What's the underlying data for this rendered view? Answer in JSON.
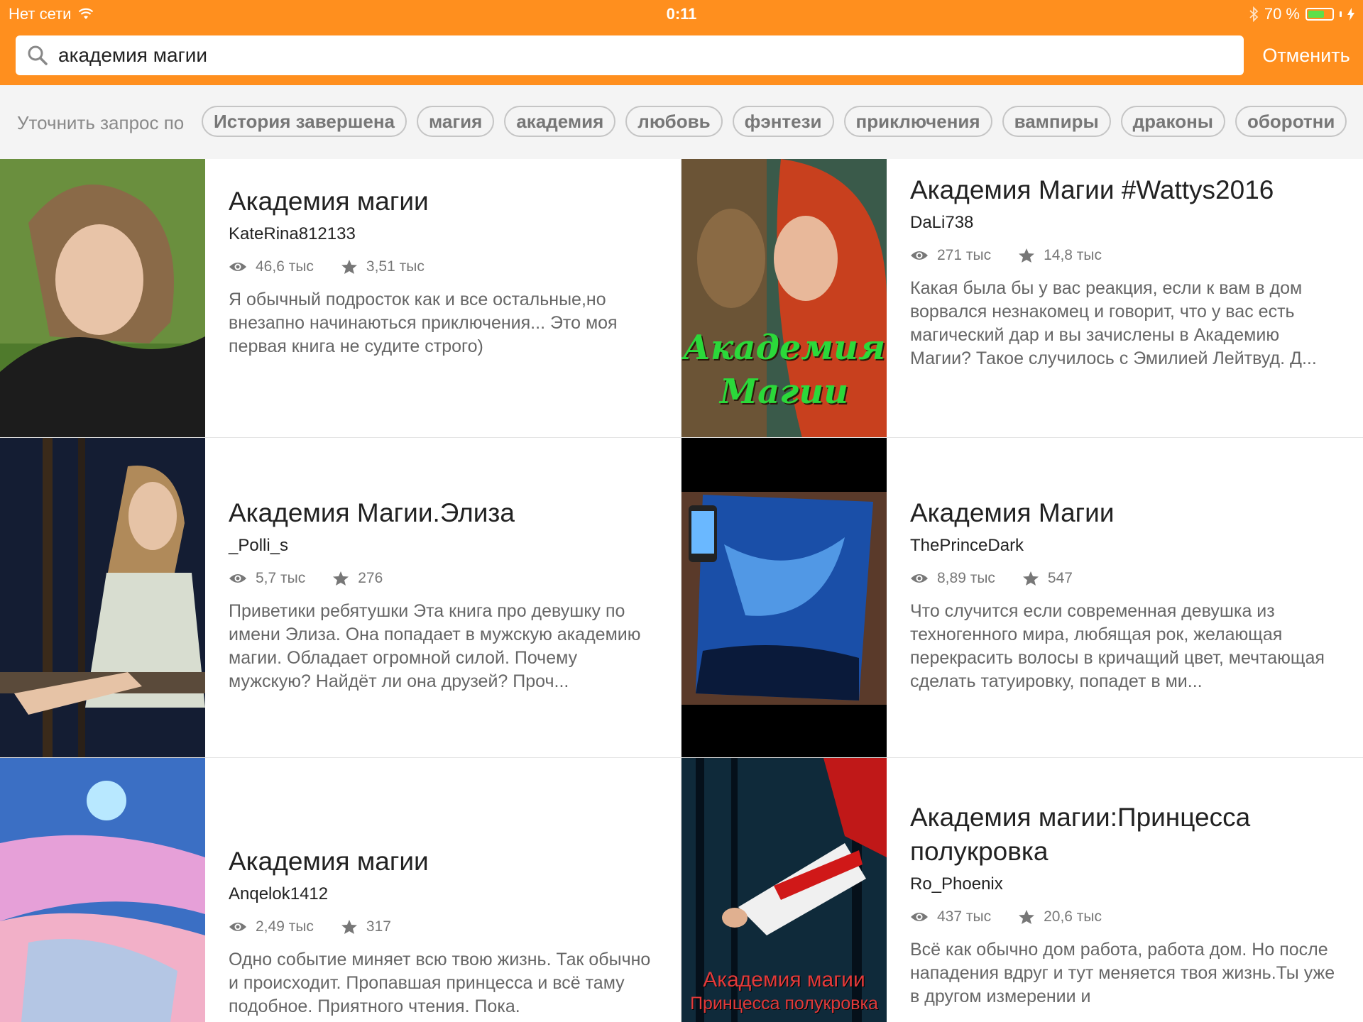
{
  "status": {
    "network": "Нет сети",
    "time": "0:11",
    "battery": "70 %",
    "battery_level": 0.7
  },
  "search": {
    "query": "академия магии",
    "cancel_label": "Отменить"
  },
  "filters": {
    "label": "Уточнить запрос по",
    "chips": [
      "История завершена",
      "магия",
      "академия",
      "любовь",
      "фэнтези",
      "приключения",
      "вампиры",
      "драконы",
      "оборотни"
    ]
  },
  "stories": [
    {
      "title": "Академия магии",
      "author": "KateRina812133",
      "views": "46,6 тыс",
      "votes": "3,51 тыс",
      "description": "Я обычный подросток как и все остальные,но внезапно начинаються приключения... Это моя первая книга не судите строго)"
    },
    {
      "title": "Академия Магии #Wattys2016",
      "author": "DaLi738",
      "views": "271 тыс",
      "votes": "14,8 тыс",
      "description": "Какая была бы у вас реакция, если к вам в дом ворвался незнакомец и говорит, что у вас есть магический дар и вы зачислены в Академию Магии? Такое случилось с Эмилией Лейтвуд. Д...",
      "cover_text": [
        "Академия",
        "Магии"
      ]
    },
    {
      "title": "Академия Магии.Элиза",
      "author": "_Polli_s",
      "views": "5,7 тыс",
      "votes": "276",
      "description": "Приветики ребятушки Эта книга про девушку по имени Элиза. Она попадает в мужскую академию магии. Обладает огромной силой. Почему мужскую? Найдёт ли она друзей? Проч..."
    },
    {
      "title": "Академия Магии",
      "author": "ThePrinceDark",
      "views": "8,89 тыс",
      "votes": "547",
      "description": "Что случится если современная девушка из техногенного мира, любящая рок, желающая перекрасить волосы в кричащий цвет, мечтающая сделать татуировку, попадет в ми..."
    },
    {
      "title": "Академия магии",
      "author": "Anqelok1412",
      "views": "2,49 тыс",
      "votes": "317",
      "description": "Одно событие миняет всю твою жизнь. Так обычно и происходит. Пропавшая принцесса и всё таму подобное. Приятного чтения. Пока."
    },
    {
      "title": "Академия магии:Принцесса полукровка",
      "author": "Ro_Phoenix",
      "views": "437 тыс",
      "votes": "20,6 тыс",
      "description": "Всё как обычно дом работа, работа дом. Но после нападения вдруг и тут меняется твоя жизнь.Ты уже в другом измерении и",
      "cover_text": [
        "Академия магии",
        "Принцесса полукровка"
      ]
    }
  ]
}
